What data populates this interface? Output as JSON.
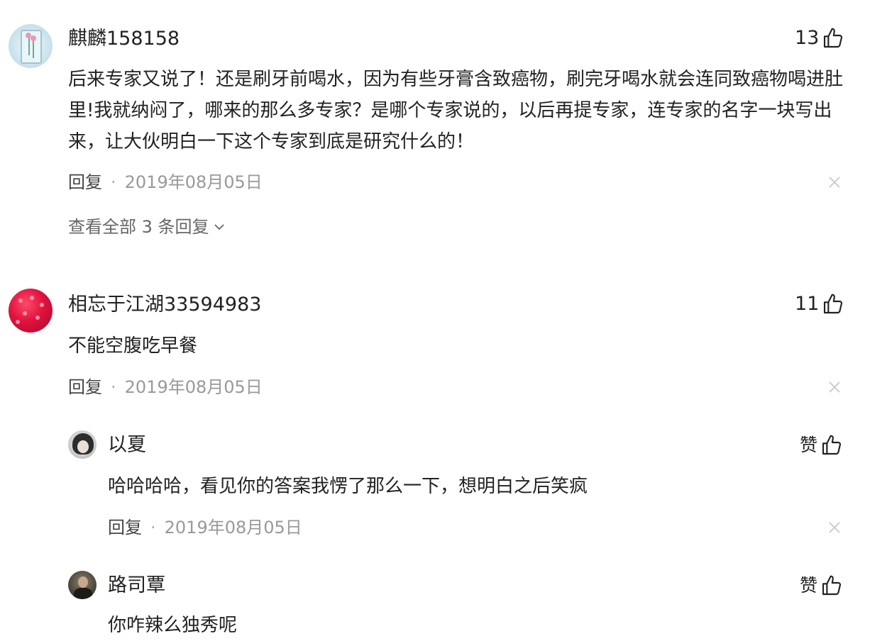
{
  "comments": [
    {
      "username": "麒麟158158",
      "likes": "13",
      "content": "后来专家又说了！还是刷牙前喝水，因为有些牙膏含致癌物，刷完牙喝水就会连同致癌物喝进肚里!我就纳闷了，哪来的那么多专家？是哪个专家说的，以后再提专家，连专家的名字一块写出来，让大伙明白一下这个专家到底是研究什么的！",
      "reply_label": "回复",
      "separator": "·",
      "date": "2019年08月05日",
      "view_replies": "查看全部 3 条回复",
      "avatar_icon": "vase-flower-avatar"
    },
    {
      "username": "相忘于江湖33594983",
      "likes": "11",
      "content": "不能空腹吃早餐",
      "reply_label": "回复",
      "separator": "·",
      "date": "2019年08月05日",
      "avatar_icon": "raspberry-avatar",
      "replies": [
        {
          "username": "以夏",
          "like_label": "赞",
          "content": "哈哈哈哈，看见你的答案我愣了那么一下，想明白之后笑疯",
          "reply_label": "回复",
          "separator": "·",
          "date": "2019年08月05日",
          "avatar_icon": "girl-portrait-avatar"
        },
        {
          "username": "路司覃",
          "like_label": "赞",
          "content": "你咋辣么独秀呢",
          "avatar_icon": "man-portrait-avatar"
        }
      ]
    }
  ],
  "colors": {
    "text": "#222222",
    "meta": "#999999",
    "secondary": "#666666",
    "close_icon": "#c8c8c8"
  }
}
